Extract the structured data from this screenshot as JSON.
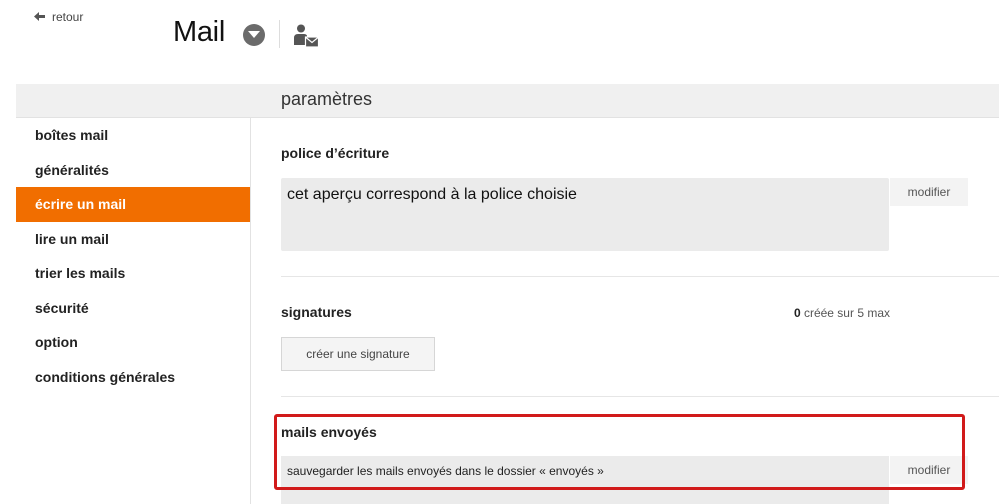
{
  "header": {
    "app_title": "Mail",
    "menu_icon": "chevron-down-circle-icon",
    "contact_icon": "user-mail-icon"
  },
  "topbar": {
    "back_label": "retour",
    "heading": "paramètres"
  },
  "sidebar": {
    "items": [
      {
        "label": "boîtes mail",
        "active": false
      },
      {
        "label": "généralités",
        "active": false
      },
      {
        "label": "écrire un mail",
        "active": true
      },
      {
        "label": "lire un mail",
        "active": false
      },
      {
        "label": "trier les mails",
        "active": false
      },
      {
        "label": "sécurité",
        "active": false
      },
      {
        "label": "option",
        "active": false
      },
      {
        "label": "conditions générales",
        "active": false
      }
    ]
  },
  "font_section": {
    "title": "police d’écriture",
    "preview_text": "cet aperçu correspond à la police choisie",
    "modify_label": "modifier"
  },
  "signatures_section": {
    "title": "signatures",
    "count_number": "0",
    "count_suffix": " créée sur 5 max",
    "create_label": "créer une signature"
  },
  "sent_section": {
    "title": "mails envoyés",
    "description": "sauvegarder les mails envoyés dans le dossier « envoyés »",
    "modify_label": "modifier"
  },
  "colors": {
    "accent": "#f16e00",
    "highlight": "#d11a1a"
  }
}
